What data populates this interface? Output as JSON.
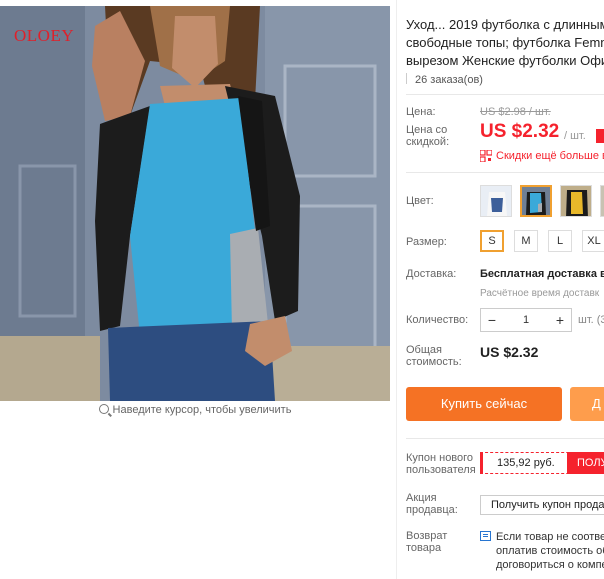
{
  "gallery": {
    "brand_mark": "OLOEY",
    "zoom_hint": "Наведите курсор, чтобы увеличить"
  },
  "product": {
    "title_lines": [
      "Уход... 2019 футболка с длинным",
      "свободные топы; футболка Femm",
      "вырезом Женские футболки Офи"
    ],
    "orders": "26 заказа(ов)"
  },
  "price": {
    "label": "Цена:",
    "old": "US $2.98 / шт.",
    "sale_label_1": "Цена со",
    "sale_label_2": "скидкой:",
    "sale": "US $2.32",
    "unit": "/ шт.",
    "qr_text": "Скидки ещё больше в"
  },
  "options": {
    "color_label": "Цвет:",
    "swatch_names": [
      "white-print",
      "blue-gray",
      "yellow-black",
      "yellow"
    ],
    "size_label": "Размер:",
    "sizes": [
      "S",
      "M",
      "L",
      "XL"
    ],
    "selected_size": "S"
  },
  "shipping": {
    "label": "Доставка:",
    "main": "Бесплатная доставка в",
    "sub": "Расчётное время доставк"
  },
  "quantity": {
    "label": "Количество:",
    "minus": "−",
    "value": "1",
    "plus": "+",
    "unit": "шт. (3"
  },
  "total": {
    "label_1": "Общая",
    "label_2": "стоимость:",
    "value": "US $2.32"
  },
  "actions": {
    "buy_now": "Купить сейчас",
    "add_to_cart": "Д"
  },
  "coupons": {
    "new_user_label_1": "Купон нового",
    "new_user_label_2": "пользователя",
    "new_user_amount": "135,92 руб.",
    "new_user_button": "ПОЛУ",
    "seller_label_1": "Акция",
    "seller_label_2": "продавца:",
    "seller_button": "Получить купон продав"
  },
  "returns": {
    "label_1": "Возврат",
    "label_2": "товара",
    "lines": [
      "Если товар не соответ",
      "оплатив стоимость об",
      "договориться о компе"
    ]
  },
  "colors": {
    "accent": "#f5222d",
    "buy": "#f57224",
    "cart": "#fe9d4c",
    "selected_border": "#f0a030"
  }
}
